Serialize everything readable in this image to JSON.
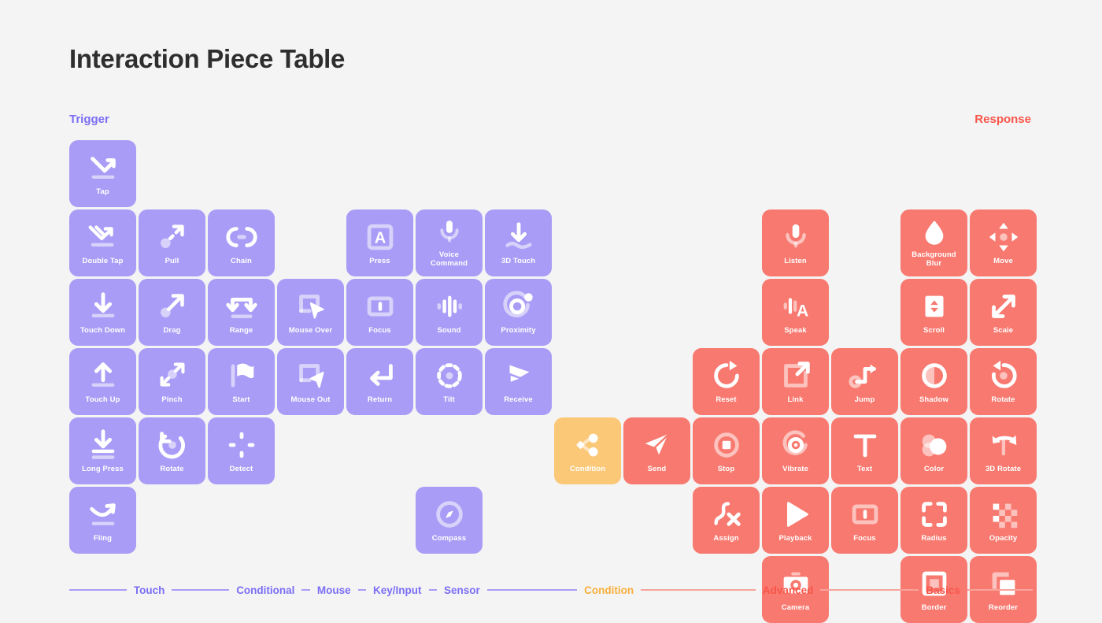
{
  "page": {
    "title": "Interaction Piece Table",
    "background_color": "#f4f4f4"
  },
  "sections": {
    "trigger_label": "Trigger",
    "response_label": "Response",
    "trigger_color": "#7b6ef6",
    "response_color": "#f8564a"
  },
  "colors": {
    "purple": "#a99cf6",
    "red": "#f8796f",
    "orange": "#fbc878",
    "label": "#ffffff"
  },
  "tiles": [
    {
      "label": "Tap",
      "icon": "tap-icon",
      "color": "purple",
      "col": 0,
      "row": 0,
      "group": "Touch"
    },
    {
      "label": "Double Tap",
      "icon": "double-tap-icon",
      "color": "purple",
      "col": 0,
      "row": 1,
      "group": "Touch"
    },
    {
      "label": "Pull",
      "icon": "pull-icon",
      "color": "purple",
      "col": 1,
      "row": 1,
      "group": "Conditional"
    },
    {
      "label": "Chain",
      "icon": "chain-icon",
      "color": "purple",
      "col": 2,
      "row": 1,
      "group": "Conditional"
    },
    {
      "label": "Press",
      "icon": "press-icon",
      "color": "purple",
      "col": 4,
      "row": 1,
      "group": "Key/Input"
    },
    {
      "label": "Voice Command",
      "icon": "voice-command-icon",
      "color": "purple",
      "col": 5,
      "row": 1,
      "group": "Sensor"
    },
    {
      "label": "3D Touch",
      "icon": "3d-touch-icon",
      "color": "purple",
      "col": 6,
      "row": 1,
      "group": "Sensor"
    },
    {
      "label": "Listen",
      "icon": "listen-icon",
      "color": "red",
      "col": 10,
      "row": 1,
      "group": "Advanced"
    },
    {
      "label": "Background Blur",
      "icon": "background-blur-icon",
      "color": "red",
      "col": 12,
      "row": 1,
      "group": "Basics"
    },
    {
      "label": "Move",
      "icon": "move-icon",
      "color": "red",
      "col": 13,
      "row": 1,
      "group": "Basics"
    },
    {
      "label": "Touch Down",
      "icon": "touch-down-icon",
      "color": "purple",
      "col": 0,
      "row": 2,
      "group": "Touch"
    },
    {
      "label": "Drag",
      "icon": "drag-icon",
      "color": "purple",
      "col": 1,
      "row": 2,
      "group": "Conditional"
    },
    {
      "label": "Range",
      "icon": "range-icon",
      "color": "purple",
      "col": 2,
      "row": 2,
      "group": "Conditional"
    },
    {
      "label": "Mouse Over",
      "icon": "mouse-over-icon",
      "color": "purple",
      "col": 3,
      "row": 2,
      "group": "Mouse"
    },
    {
      "label": "Focus",
      "icon": "focus-icon",
      "color": "purple",
      "col": 4,
      "row": 2,
      "group": "Key/Input"
    },
    {
      "label": "Sound",
      "icon": "sound-icon",
      "color": "purple",
      "col": 5,
      "row": 2,
      "group": "Sensor"
    },
    {
      "label": "Proximity",
      "icon": "proximity-icon",
      "color": "purple",
      "col": 6,
      "row": 2,
      "group": "Sensor"
    },
    {
      "label": "Speak",
      "icon": "speak-icon",
      "color": "red",
      "col": 10,
      "row": 2,
      "group": "Advanced"
    },
    {
      "label": "Scroll",
      "icon": "scroll-icon",
      "color": "red",
      "col": 12,
      "row": 2,
      "group": "Basics"
    },
    {
      "label": "Scale",
      "icon": "scale-icon",
      "color": "red",
      "col": 13,
      "row": 2,
      "group": "Basics"
    },
    {
      "label": "Touch Up",
      "icon": "touch-up-icon",
      "color": "purple",
      "col": 0,
      "row": 3,
      "group": "Touch"
    },
    {
      "label": "Pinch",
      "icon": "pinch-icon",
      "color": "purple",
      "col": 1,
      "row": 3,
      "group": "Conditional"
    },
    {
      "label": "Start",
      "icon": "start-icon",
      "color": "purple",
      "col": 2,
      "row": 3,
      "group": "Conditional"
    },
    {
      "label": "Mouse Out",
      "icon": "mouse-out-icon",
      "color": "purple",
      "col": 3,
      "row": 3,
      "group": "Mouse"
    },
    {
      "label": "Return",
      "icon": "return-icon",
      "color": "purple",
      "col": 4,
      "row": 3,
      "group": "Key/Input"
    },
    {
      "label": "Tilt",
      "icon": "tilt-icon",
      "color": "purple",
      "col": 5,
      "row": 3,
      "group": "Sensor"
    },
    {
      "label": "Receive",
      "icon": "receive-icon",
      "color": "purple",
      "col": 6,
      "row": 3,
      "group": "Sensor"
    },
    {
      "label": "Reset",
      "icon": "reset-icon",
      "color": "red",
      "col": 9,
      "row": 3,
      "group": "Advanced"
    },
    {
      "label": "Link",
      "icon": "link-icon",
      "color": "red",
      "col": 10,
      "row": 3,
      "group": "Advanced"
    },
    {
      "label": "Jump",
      "icon": "jump-icon",
      "color": "red",
      "col": 11,
      "row": 3,
      "group": "Advanced"
    },
    {
      "label": "Shadow",
      "icon": "shadow-icon",
      "color": "red",
      "col": 12,
      "row": 3,
      "group": "Basics"
    },
    {
      "label": "Rotate",
      "icon": "rotate-basics-icon",
      "color": "red",
      "col": 13,
      "row": 3,
      "group": "Basics"
    },
    {
      "label": "Long Press",
      "icon": "long-press-icon",
      "color": "purple",
      "col": 0,
      "row": 4,
      "group": "Touch"
    },
    {
      "label": "Rotate",
      "icon": "rotate-trigger-icon",
      "color": "purple",
      "col": 1,
      "row": 4,
      "group": "Conditional"
    },
    {
      "label": "Detect",
      "icon": "detect-icon",
      "color": "purple",
      "col": 2,
      "row": 4,
      "group": "Conditional"
    },
    {
      "label": "Condition",
      "icon": "condition-icon",
      "color": "orange",
      "col": 7,
      "row": 4,
      "group": "Condition"
    },
    {
      "label": "Send",
      "icon": "send-icon",
      "color": "red",
      "col": 8,
      "row": 4,
      "group": "Advanced"
    },
    {
      "label": "Stop",
      "icon": "stop-icon",
      "color": "red",
      "col": 9,
      "row": 4,
      "group": "Advanced"
    },
    {
      "label": "Vibrate",
      "icon": "vibrate-icon",
      "color": "red",
      "col": 10,
      "row": 4,
      "group": "Advanced"
    },
    {
      "label": "Text",
      "icon": "text-icon",
      "color": "red",
      "col": 11,
      "row": 4,
      "group": "Advanced"
    },
    {
      "label": "Color",
      "icon": "color-icon",
      "color": "red",
      "col": 12,
      "row": 4,
      "group": "Basics"
    },
    {
      "label": "3D Rotate",
      "icon": "3d-rotate-icon",
      "color": "red",
      "col": 13,
      "row": 4,
      "group": "Basics"
    },
    {
      "label": "Fling",
      "icon": "fling-icon",
      "color": "purple",
      "col": 0,
      "row": 5,
      "group": "Touch"
    },
    {
      "label": "Compass",
      "icon": "compass-icon",
      "color": "purple",
      "col": 5,
      "row": 5,
      "group": "Sensor"
    },
    {
      "label": "Assign",
      "icon": "assign-icon",
      "color": "red",
      "col": 9,
      "row": 5,
      "group": "Advanced"
    },
    {
      "label": "Playback",
      "icon": "playback-icon",
      "color": "red",
      "col": 10,
      "row": 5,
      "group": "Advanced"
    },
    {
      "label": "Focus",
      "icon": "focus-response-icon",
      "color": "red",
      "col": 11,
      "row": 5,
      "group": "Advanced"
    },
    {
      "label": "Radius",
      "icon": "radius-icon",
      "color": "red",
      "col": 12,
      "row": 5,
      "group": "Basics"
    },
    {
      "label": "Opacity",
      "icon": "opacity-icon",
      "color": "red",
      "col": 13,
      "row": 5,
      "group": "Basics"
    },
    {
      "label": "Camera",
      "icon": "camera-icon",
      "color": "red",
      "col": 10,
      "row": 6,
      "group": "Advanced"
    },
    {
      "label": "Border",
      "icon": "border-icon",
      "color": "red",
      "col": 12,
      "row": 6,
      "group": "Basics"
    },
    {
      "label": "Reorder",
      "icon": "reorder-icon",
      "color": "red",
      "col": 13,
      "row": 6,
      "group": "Basics"
    }
  ],
  "legend": [
    {
      "label": "Touch",
      "color_class": "purple",
      "lead": 66,
      "trail": 0
    },
    {
      "label": "Conditional",
      "color_class": "purple",
      "lead": 0,
      "trail": 0
    },
    {
      "label": "Mouse",
      "color_class": "purple",
      "lead": 0,
      "trail": 0
    },
    {
      "label": "Key/Input",
      "color_class": "purple",
      "lead": 0,
      "trail": 0
    },
    {
      "label": "Sensor",
      "color_class": "purple",
      "lead": 0,
      "trail": 0
    },
    {
      "label": "Condition",
      "color_class": "orange",
      "lead": 0,
      "trail": 0
    },
    {
      "label": "Advanced",
      "color_class": "red",
      "lead": 0,
      "trail": 0
    },
    {
      "label": "Basics",
      "color_class": "red",
      "lead": 0,
      "trail": 64
    }
  ],
  "legend_weights": {
    "Touch": [
      7,
      7
    ],
    "Conditional": [
      7,
      1
    ],
    "Mouse": [
      1,
      1
    ],
    "Key/Input": [
      1,
      1
    ],
    "Sensor": [
      1,
      11
    ],
    "Condition": [
      11,
      14
    ],
    "Advanced": [
      14,
      12
    ],
    "Basics": [
      12,
      8
    ]
  }
}
